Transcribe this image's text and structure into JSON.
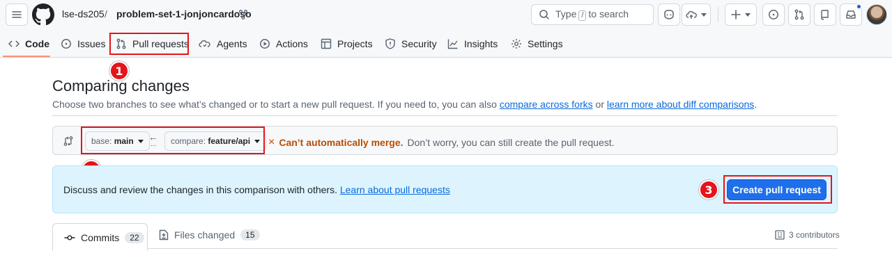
{
  "header": {
    "owner": "lse-ds205",
    "separator": "/",
    "repo": "problem-set-1-jonjoncardoso",
    "search": {
      "prefix": "Type",
      "key": "/",
      "suffix": "to search"
    },
    "icons": [
      "menu-icon",
      "github-logo",
      "fork-icon",
      "search-icon",
      "copilot-icon",
      "code-cloud-icon",
      "plus-icon",
      "issues-icon",
      "pull-request-icon",
      "inbox-icon",
      "avatar"
    ]
  },
  "repo_nav": {
    "tabs": [
      {
        "label": "Code",
        "icon": "code-icon",
        "active": true
      },
      {
        "label": "Issues",
        "icon": "issue-icon"
      },
      {
        "label": "Pull requests",
        "icon": "pull-request-icon"
      },
      {
        "label": "Agents",
        "icon": "agents-icon"
      },
      {
        "label": "Actions",
        "icon": "play-icon"
      },
      {
        "label": "Projects",
        "icon": "table-icon"
      },
      {
        "label": "Security",
        "icon": "shield-icon"
      },
      {
        "label": "Insights",
        "icon": "graph-icon"
      },
      {
        "label": "Settings",
        "icon": "gear-icon"
      }
    ]
  },
  "annotations": {
    "step1": "1",
    "step2": "2",
    "step3": "3",
    "color": "#e5141b"
  },
  "compare": {
    "title": "Comparing changes",
    "subtitle_before": "Choose two branches to see what’s changed or to start a new pull request. If you need to, you can also ",
    "link_forks": "compare across forks",
    "subtitle_mid": " or ",
    "link_learn": "learn more about diff comparisons",
    "subtitle_end": ".",
    "base": {
      "prefix": "base:",
      "branch": "main"
    },
    "head": {
      "prefix": "compare:",
      "branch": "feature/api"
    },
    "arrow": "←",
    "arrow_dots": "...",
    "merge_icon": "×",
    "merge_bad": "Can’t automatically merge.",
    "merge_note": "Don’t worry, you can still create the pull request."
  },
  "blurb": {
    "text": "Discuss and review the changes in this comparison with others.",
    "link": "Learn about pull requests",
    "button": "Create pull request"
  },
  "bottom_tabs": {
    "commits_label": "Commits",
    "commits_count": "22",
    "files_label": "Files changed",
    "files_count": "15",
    "contributors": "3 contributors"
  },
  "colors": {
    "accent": "#0969da",
    "primary_button": "#1f6feb",
    "warning": "#bc4c00",
    "tab_underline": "#fd8c73"
  }
}
